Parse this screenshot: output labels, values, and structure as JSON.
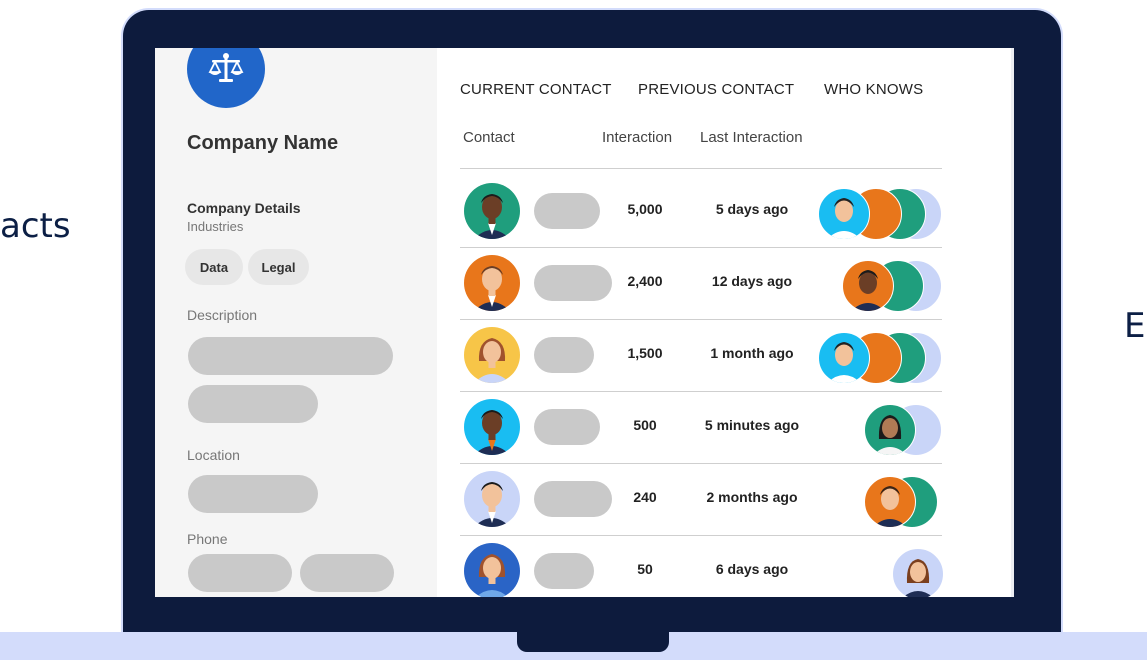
{
  "page": {
    "left_fragment": "acts",
    "right_fragment": "E"
  },
  "sidebar": {
    "logo_icon": "scales-icon",
    "company_name": "Company Name",
    "details_heading": "Company Details",
    "industries_label": "Industries",
    "tags": [
      "Data",
      "Legal"
    ],
    "description_label": "Description",
    "location_label": "Location",
    "phone_label": "Phone"
  },
  "main": {
    "tabs": [
      "CURRENT CONTACT",
      "PREVIOUS CONTACT",
      "WHO KNOWS"
    ],
    "columns": [
      "Contact",
      "Interaction",
      "Last Interaction"
    ],
    "rows": [
      {
        "interactions": "5,000",
        "last": "5 days ago"
      },
      {
        "interactions": "2,400",
        "last": "12 days ago"
      },
      {
        "interactions": "1,500",
        "last": "1 month ago"
      },
      {
        "interactions": "500",
        "last": "5 minutes ago"
      },
      {
        "interactions": "240",
        "last": "2 months ago"
      },
      {
        "interactions": "50",
        "last": "6 days ago"
      }
    ]
  },
  "colors": {
    "frame": "#0d1b3d",
    "logo": "#2166c9",
    "avatar_teal": "#1f9e7d",
    "avatar_orange": "#e8761b",
    "avatar_yellow": "#f7c548",
    "avatar_cyan": "#19bdf2",
    "avatar_lilac": "#c9d5f8",
    "avatar_blue": "#2a64c6"
  }
}
